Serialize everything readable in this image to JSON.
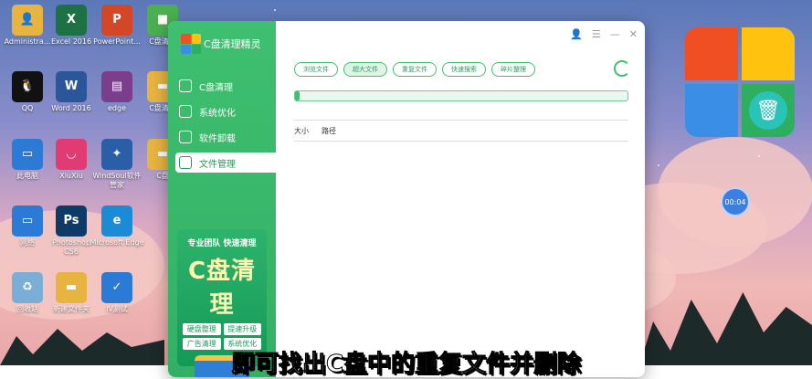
{
  "desktop_icons": [
    {
      "label": "Administra...",
      "color": "#e8b441",
      "glyph": "👤"
    },
    {
      "label": "Excel 2016",
      "color": "#1e7145",
      "glyph": "X"
    },
    {
      "label": "PowerPoint...",
      "color": "#d24726",
      "glyph": "P"
    },
    {
      "label": "C盘清理",
      "color": "#4caf50",
      "glyph": "■"
    },
    {
      "label": "QQ",
      "color": "#111111",
      "glyph": "🐧"
    },
    {
      "label": "Word 2016",
      "color": "#2b579a",
      "glyph": "W"
    },
    {
      "label": "edge",
      "color": "#7a3e8c",
      "glyph": "▤"
    },
    {
      "label": "C盘清理",
      "color": "#e8b441",
      "glyph": "▬"
    },
    {
      "label": "此电脑",
      "color": "#2b7bd6",
      "glyph": "▭"
    },
    {
      "label": "XiuXiu",
      "color": "#e13b73",
      "glyph": "◡"
    },
    {
      "label": "WindSoul软件管家",
      "color": "#2a5fa8",
      "glyph": "✦"
    },
    {
      "label": "C盘",
      "color": "#e8b441",
      "glyph": "▬"
    },
    {
      "label": "网络",
      "color": "#2b7bd6",
      "glyph": "▭"
    },
    {
      "label": "Photoshop CS6",
      "color": "#0d3a66",
      "glyph": "Ps"
    },
    {
      "label": "Microsoft Edge",
      "color": "#1b8bd6",
      "glyph": "e"
    },
    {
      "label": "回收站",
      "color": "#7aaed6",
      "glyph": "♻"
    },
    {
      "label": "新建文件夹",
      "color": "#e8b441",
      "glyph": "▬"
    },
    {
      "label": "IV测试",
      "color": "#2b7bd6",
      "glyph": "✓"
    }
  ],
  "app": {
    "title": "C盘清理精灵",
    "nav": [
      {
        "label": "C盘清理"
      },
      {
        "label": "系统优化"
      },
      {
        "label": "软件卸载"
      },
      {
        "label": "文件管理"
      }
    ],
    "promo": {
      "tagline": "专业团队 快速清理",
      "headline": "C盘清理",
      "tags": [
        "硬盘整理",
        "提速升级",
        "广告清理",
        "系统优化"
      ]
    },
    "tabs": [
      "浏览文件",
      "超大文件",
      "重复文件",
      "快速搜索",
      "碎片整理"
    ],
    "active_tab": "超大文件",
    "progress": 0.015,
    "columns": [
      "大小",
      "路径"
    ]
  },
  "overlay": {
    "timer": "00:04",
    "caption": "即可找出C盘中的重复文件并删除"
  },
  "colors": {
    "accent": "#3fbf70",
    "brand_dark": "#2d9a57"
  }
}
